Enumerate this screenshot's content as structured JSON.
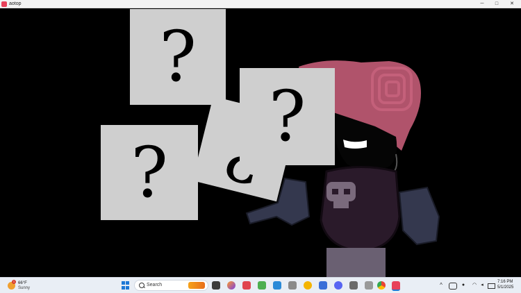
{
  "window": {
    "title": "aotop",
    "minimize": "─",
    "maximize": "□",
    "close": "✕"
  },
  "game": {
    "cards": [
      {
        "symbol": "?"
      },
      {
        "symbol": "?"
      },
      {
        "symbol": "?"
      },
      {
        "symbol": "¿"
      }
    ]
  },
  "taskbar": {
    "weather": {
      "temp": "66°F",
      "condition": "Sunny",
      "badge": "1"
    },
    "search_placeholder": "Search",
    "apps": [
      "file-explorer-icon",
      "firefox-icon",
      "brave-icon",
      "minecraft-icon",
      "vscode-icon",
      "chrome-dev-icon",
      "notepad-icon",
      "discord-icon",
      "tool-icon",
      "chess-icon",
      "chrome-icon",
      "aotop-app-icon"
    ],
    "tray": {
      "chevron": "^",
      "mic": "🎤",
      "wifi": "wifi",
      "volume": "🔊"
    },
    "clock": {
      "time": "7:16 PM",
      "date": "5/1/2025"
    }
  }
}
